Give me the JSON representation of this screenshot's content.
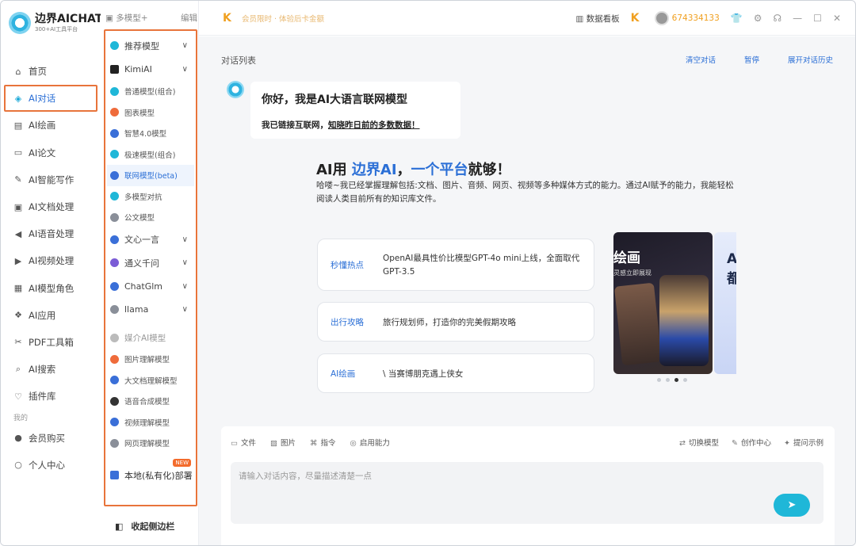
{
  "brand": {
    "name": "边界AICHAT",
    "sub": "300+AI工具平台"
  },
  "nav": {
    "items": [
      {
        "label": "首页",
        "icon": "home-icon",
        "glyph": "⌂",
        "active": false
      },
      {
        "label": "AI对话",
        "icon": "chat-cube-icon",
        "glyph": "◈",
        "active": true
      },
      {
        "label": "AI绘画",
        "icon": "image-icon",
        "glyph": "▤",
        "active": false
      },
      {
        "label": "AI论文",
        "icon": "document-icon",
        "glyph": "▭",
        "active": false
      },
      {
        "label": "AI智能写作",
        "icon": "pen-icon",
        "glyph": "✎",
        "active": false
      },
      {
        "label": "AI文档处理",
        "icon": "text-doc-icon",
        "glyph": "▣",
        "active": false
      },
      {
        "label": "AI语音处理",
        "icon": "speaker-icon",
        "glyph": "◀",
        "active": false
      },
      {
        "label": "AI视频处理",
        "icon": "video-icon",
        "glyph": "▶",
        "active": false
      },
      {
        "label": "AI模型角色",
        "icon": "role-icon",
        "glyph": "▦",
        "active": false
      },
      {
        "label": "AI应用",
        "icon": "apps-icon",
        "glyph": "❖",
        "active": false
      },
      {
        "label": "PDF工具箱",
        "icon": "wrench-icon",
        "glyph": "✂",
        "active": false
      },
      {
        "label": "AI搜索",
        "icon": "search-icon",
        "glyph": "⌕",
        "active": false
      },
      {
        "label": "插件库",
        "icon": "plugin-icon",
        "glyph": "♡",
        "active": false
      }
    ],
    "section_label": "我的",
    "bottom_items": [
      {
        "label": "会员购买",
        "icon": "member-icon",
        "glyph": "●"
      },
      {
        "label": "个人中心",
        "icon": "user-icon",
        "glyph": "○"
      }
    ]
  },
  "submenu": {
    "header": "多模型+",
    "edit": "编辑",
    "items": [
      {
        "label": "推荐模型",
        "type": "big",
        "chevron": "∨",
        "color": "#1fb7d8",
        "icon": "recommend-icon"
      },
      {
        "label": "KimiAI",
        "type": "big",
        "chevron": "∨",
        "color": "#222222",
        "icon": "kimi-icon"
      },
      {
        "label": "普通模型(组合)",
        "type": "item",
        "color": "#1fb7d8",
        "icon": "model-icon"
      },
      {
        "label": "图表模型",
        "type": "item",
        "color": "#ef6b3b",
        "icon": "chart-icon"
      },
      {
        "label": "智慧4.0模型",
        "type": "item",
        "color": "#3a6fd8",
        "icon": "brain-icon"
      },
      {
        "label": "极速模型(组合)",
        "type": "item",
        "color": "#1fb7d8",
        "icon": "speed-icon"
      },
      {
        "label": "联网模型(beta)",
        "type": "item",
        "selected": true,
        "color": "#3a6fd8",
        "icon": "globe-icon"
      },
      {
        "label": "多模型对抗",
        "type": "item",
        "color": "#1fb7d8",
        "icon": "versus-icon"
      },
      {
        "label": "公文模型",
        "type": "item",
        "color": "#8a8f99",
        "icon": "official-doc-icon"
      },
      {
        "label": "文心一言",
        "type": "big",
        "chevron": "∨",
        "color": "#3a6fd8",
        "icon": "wenxin-icon"
      },
      {
        "label": "通义千问",
        "type": "big",
        "chevron": "∨",
        "color": "#7b5cd6",
        "icon": "tongyi-icon"
      },
      {
        "label": "ChatGlm",
        "type": "big",
        "chevron": "∨",
        "color": "#3a6fd8",
        "icon": "chatglm-icon"
      },
      {
        "label": "llama",
        "type": "big",
        "chevron": "∨",
        "color": "#8a8f99",
        "icon": "llama-icon"
      },
      {
        "label": "媒介AI模型",
        "type": "media",
        "color": "#bbbbbb",
        "icon": "media-icon"
      },
      {
        "label": "图片理解模型",
        "type": "item",
        "color": "#ef6b3b",
        "icon": "image-understand-icon"
      },
      {
        "label": "大文档理解模型",
        "type": "item",
        "color": "#3a6fd8",
        "icon": "bigdoc-icon"
      },
      {
        "label": "语音合成模型",
        "type": "item",
        "color": "#333333",
        "icon": "headphone-icon"
      },
      {
        "label": "视频理解模型",
        "type": "item",
        "color": "#3a6fd8",
        "icon": "video-understand-icon"
      },
      {
        "label": "网页理解模型",
        "type": "item",
        "color": "#8a8f99",
        "icon": "webpage-icon"
      }
    ],
    "local": {
      "label": "本地(私有化)部署",
      "badge": "NEW"
    },
    "collapse": "收起侧边栏"
  },
  "topbar": {
    "promo": "会员限时 · 体验后卡金额",
    "dashboard": "数据看板",
    "user_id": "674334133"
  },
  "main": {
    "list_title": "对话列表",
    "links": [
      "清空对话",
      "暂停",
      "展开对话历史"
    ],
    "greeting": {
      "title": "你好，我是AI大语言联网模型",
      "sub_prefix": "我已链接互联网，",
      "sub_underline": "知晓昨日前的多数数据！"
    },
    "hero": {
      "t1": "AI用 ",
      "t2": "边界AI",
      "t3": "，",
      "t4": "一个平台",
      "t5": "就够！",
      "desc": "哈喽~我已经掌握理解包括:文档、图片、音频、网页、视频等多种媒体方式的能力。通过AI赋予的能力，我能轻松阅读人类目前所有的知识库文件。"
    },
    "prompts": [
      {
        "tag": "秒懂热点",
        "text": "OpenAI最具性价比模型GPT-4o mini上线，全面取代GPT-3.5"
      },
      {
        "tag": "出行攻略",
        "text": "旅行规划师，打造你的完美假期攻略"
      },
      {
        "tag": "AI绘画",
        "text": "\\ 当赛博朋克遇上侠女"
      }
    ],
    "carousel": {
      "slide1_title": "绘画",
      "slide1_sub": "灵感立即展现",
      "slide2_title": "A",
      "slide2_title2": "都",
      "dots": 4,
      "active_dot": 3
    }
  },
  "composer": {
    "tools": [
      {
        "label": "文件",
        "icon": "file-icon",
        "glyph": "▭"
      },
      {
        "label": "图片",
        "icon": "picture-icon",
        "glyph": "▨"
      },
      {
        "label": "指令",
        "icon": "command-icon",
        "glyph": "⌘"
      },
      {
        "label": "启用能力",
        "icon": "ability-icon",
        "glyph": "◎"
      }
    ],
    "right_tools": [
      {
        "label": "切换模型",
        "icon": "switch-model-icon",
        "glyph": "⇄"
      },
      {
        "label": "创作中心",
        "icon": "create-center-icon",
        "glyph": "✎"
      },
      {
        "label": "提问示例",
        "icon": "example-icon",
        "glyph": "✦"
      }
    ],
    "placeholder": "请输入对话内容，尽量描述清楚一点"
  }
}
